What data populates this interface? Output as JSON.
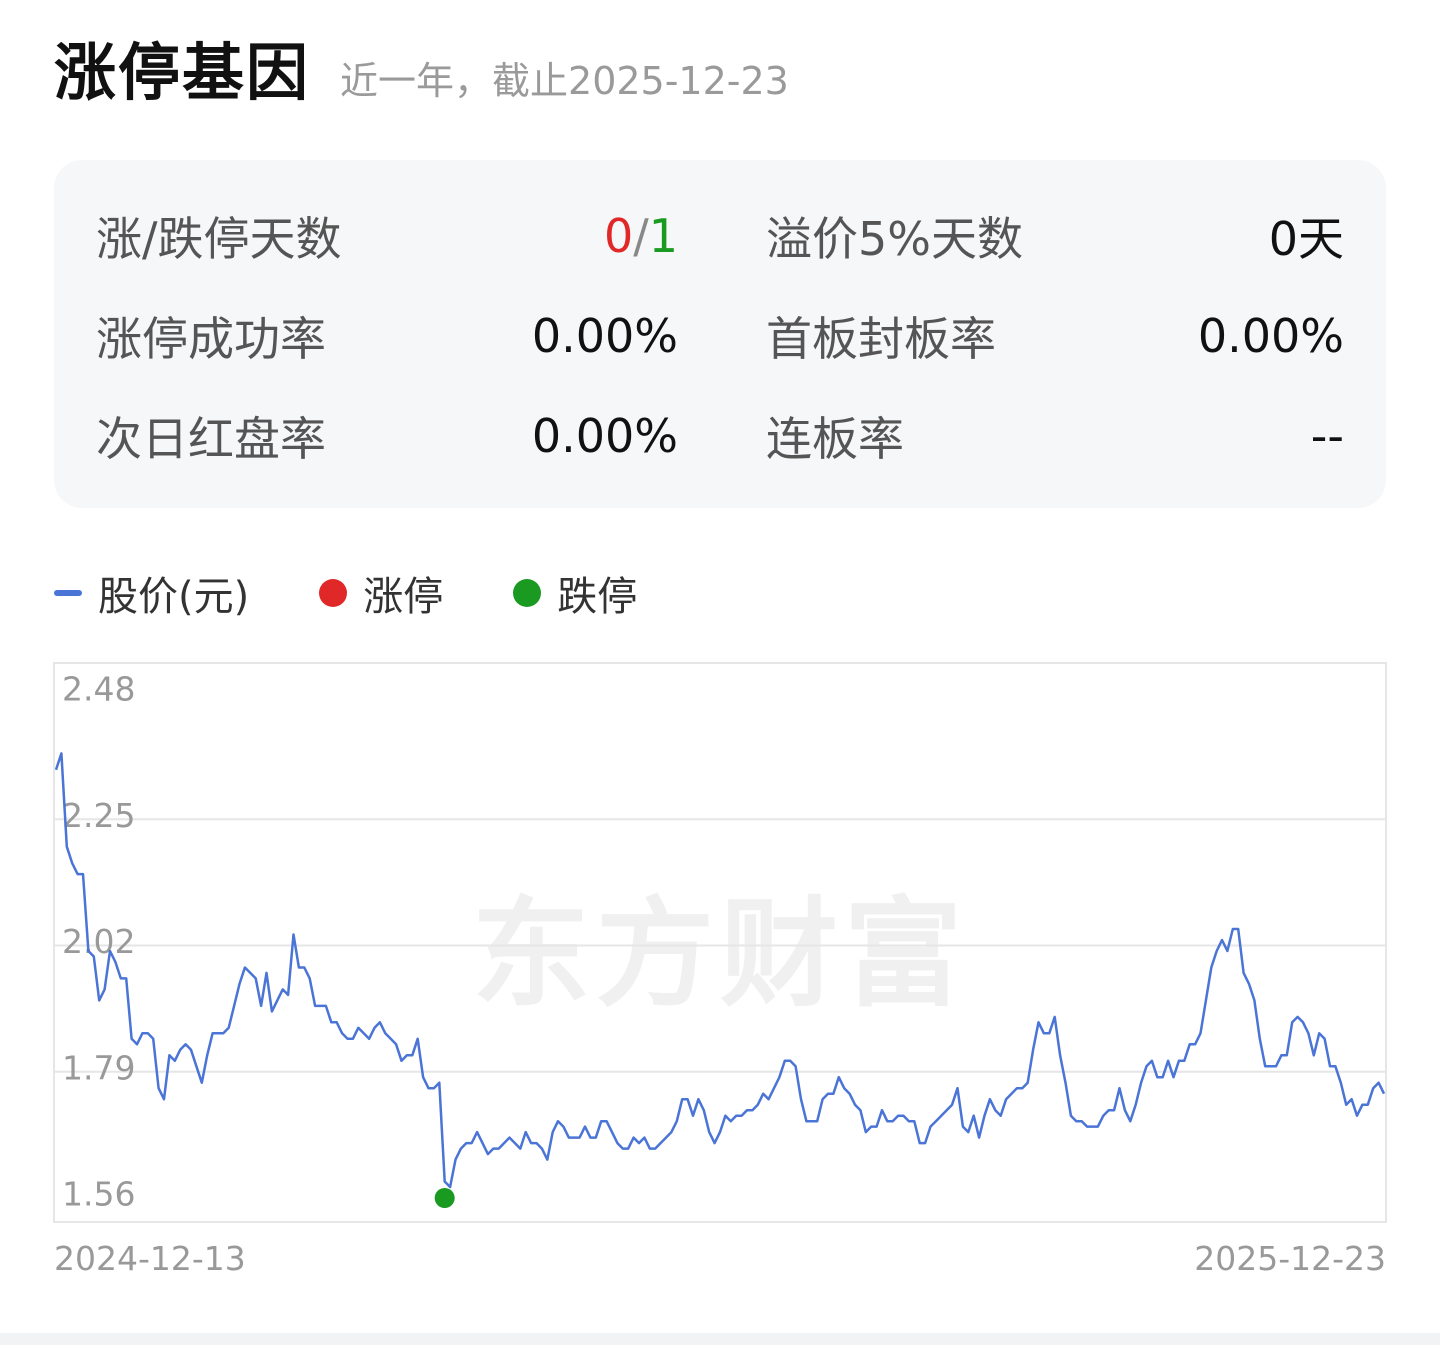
{
  "header": {
    "title": "涨停基因",
    "subtitle": "近一年，截止2025-12-23"
  },
  "stats": {
    "rows": [
      {
        "left_label": "涨/跌停天数",
        "left_value_up": "0",
        "left_value_sep": "/",
        "left_value_down": "1",
        "right_label": "溢价5%天数",
        "right_value": "0天"
      },
      {
        "left_label": "涨停成功率",
        "left_value": "0.00%",
        "right_label": "首板封板率",
        "right_value": "0.00%"
      },
      {
        "left_label": "次日红盘率",
        "left_value": "0.00%",
        "right_label": "连板率",
        "right_value": "--"
      }
    ]
  },
  "legend": {
    "price_label": "股价(元)",
    "limit_up_label": "涨停",
    "limit_down_label": "跌停"
  },
  "colors": {
    "line": "#4a74d6",
    "limit_up": "#e02828",
    "limit_down": "#1a9a20",
    "grid": "#e6e6e6"
  },
  "chart_data": {
    "type": "line",
    "watermark": "东方财富",
    "x_start_label": "2024-12-13",
    "x_end_label": "2025-12-23",
    "ylim": [
      1.56,
      2.48
    ],
    "yticks": [
      "2.48",
      "2.25",
      "2.02",
      "1.79",
      "1.56"
    ],
    "series": [
      {
        "name": "股价(元)",
        "values": [
          2.34,
          2.37,
          2.2,
          2.17,
          2.15,
          2.15,
          2.01,
          2.0,
          1.92,
          1.94,
          2.01,
          1.99,
          1.96,
          1.96,
          1.85,
          1.84,
          1.86,
          1.86,
          1.85,
          1.76,
          1.74,
          1.82,
          1.81,
          1.83,
          1.84,
          1.83,
          1.8,
          1.77,
          1.82,
          1.86,
          1.86,
          1.86,
          1.87,
          1.91,
          1.95,
          1.98,
          1.97,
          1.96,
          1.91,
          1.97,
          1.9,
          1.92,
          1.94,
          1.93,
          2.04,
          1.98,
          1.98,
          1.96,
          1.91,
          1.91,
          1.91,
          1.88,
          1.88,
          1.86,
          1.85,
          1.85,
          1.87,
          1.86,
          1.85,
          1.87,
          1.88,
          1.86,
          1.85,
          1.84,
          1.81,
          1.82,
          1.82,
          1.85,
          1.78,
          1.76,
          1.76,
          1.77,
          1.59,
          1.58,
          1.63,
          1.65,
          1.66,
          1.66,
          1.68,
          1.66,
          1.64,
          1.65,
          1.65,
          1.66,
          1.67,
          1.66,
          1.65,
          1.68,
          1.66,
          1.66,
          1.65,
          1.63,
          1.68,
          1.7,
          1.69,
          1.67,
          1.67,
          1.67,
          1.69,
          1.67,
          1.67,
          1.7,
          1.7,
          1.68,
          1.66,
          1.65,
          1.65,
          1.67,
          1.66,
          1.67,
          1.65,
          1.65,
          1.66,
          1.67,
          1.68,
          1.7,
          1.74,
          1.74,
          1.71,
          1.74,
          1.72,
          1.68,
          1.66,
          1.68,
          1.71,
          1.7,
          1.71,
          1.71,
          1.72,
          1.72,
          1.73,
          1.75,
          1.74,
          1.76,
          1.78,
          1.81,
          1.81,
          1.8,
          1.74,
          1.7,
          1.7,
          1.7,
          1.74,
          1.75,
          1.75,
          1.78,
          1.76,
          1.75,
          1.73,
          1.72,
          1.68,
          1.69,
          1.69,
          1.72,
          1.7,
          1.7,
          1.71,
          1.71,
          1.7,
          1.7,
          1.66,
          1.66,
          1.69,
          1.7,
          1.71,
          1.72,
          1.73,
          1.76,
          1.69,
          1.68,
          1.71,
          1.67,
          1.71,
          1.74,
          1.72,
          1.71,
          1.74,
          1.75,
          1.76,
          1.76,
          1.77,
          1.83,
          1.88,
          1.86,
          1.86,
          1.89,
          1.82,
          1.77,
          1.71,
          1.7,
          1.7,
          1.69,
          1.69,
          1.69,
          1.71,
          1.72,
          1.72,
          1.76,
          1.72,
          1.7,
          1.73,
          1.77,
          1.8,
          1.81,
          1.78,
          1.78,
          1.81,
          1.78,
          1.81,
          1.81,
          1.84,
          1.84,
          1.86,
          1.92,
          1.98,
          2.01,
          2.03,
          2.01,
          2.05,
          2.05,
          1.97,
          1.95,
          1.92,
          1.85,
          1.8,
          1.8,
          1.8,
          1.82,
          1.82,
          1.88,
          1.89,
          1.88,
          1.86,
          1.82,
          1.86,
          1.85,
          1.8,
          1.8,
          1.77,
          1.73,
          1.74,
          1.71,
          1.73,
          1.73,
          1.76,
          1.77,
          1.75
        ]
      }
    ],
    "limit_down_points": [
      {
        "index": 72,
        "value": 1.56
      }
    ],
    "limit_up_points": []
  }
}
